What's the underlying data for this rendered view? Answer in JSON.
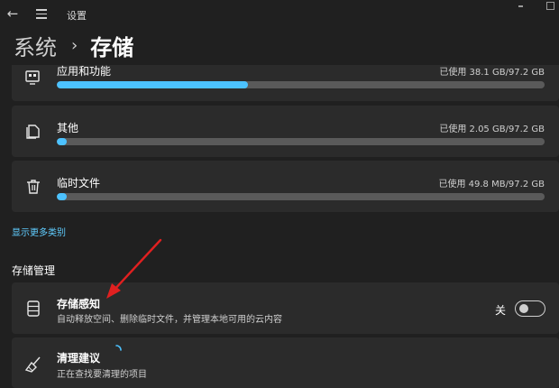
{
  "window": {
    "title": "设置"
  },
  "breadcrumb": {
    "parent": "系统",
    "separator": "›",
    "current": "存储"
  },
  "categories": [
    {
      "label": "应用和功能",
      "usage": "已使用 38.1 GB/97.2 GB",
      "fill_fraction": 0.392,
      "icon": "apps-icon"
    },
    {
      "label": "其他",
      "usage": "已使用 2.05 GB/97.2 GB",
      "fill_fraction": 0.021,
      "icon": "document-icon"
    },
    {
      "label": "临时文件",
      "usage": "已使用 49.8 MB/97.2 GB",
      "fill_fraction": 0.0005,
      "icon": "trash-icon"
    }
  ],
  "show_more_link": "显示更多类别",
  "section_title": "存储管理",
  "storage_sense": {
    "title": "存储感知",
    "description": "自动释放空间、删除临时文件，并管理本地可用的云内容",
    "toggle_label": "关",
    "toggle_on": false,
    "icon": "storage-drive-icon"
  },
  "cleanup": {
    "title": "清理建议",
    "description": "正在查找要清理的项目",
    "icon": "broom-icon"
  },
  "colors": {
    "accent": "#4cc2ff",
    "link": "#60cdff",
    "card": "#2b2b2b",
    "background": "#202020",
    "annotation_arrow": "#e02020"
  }
}
